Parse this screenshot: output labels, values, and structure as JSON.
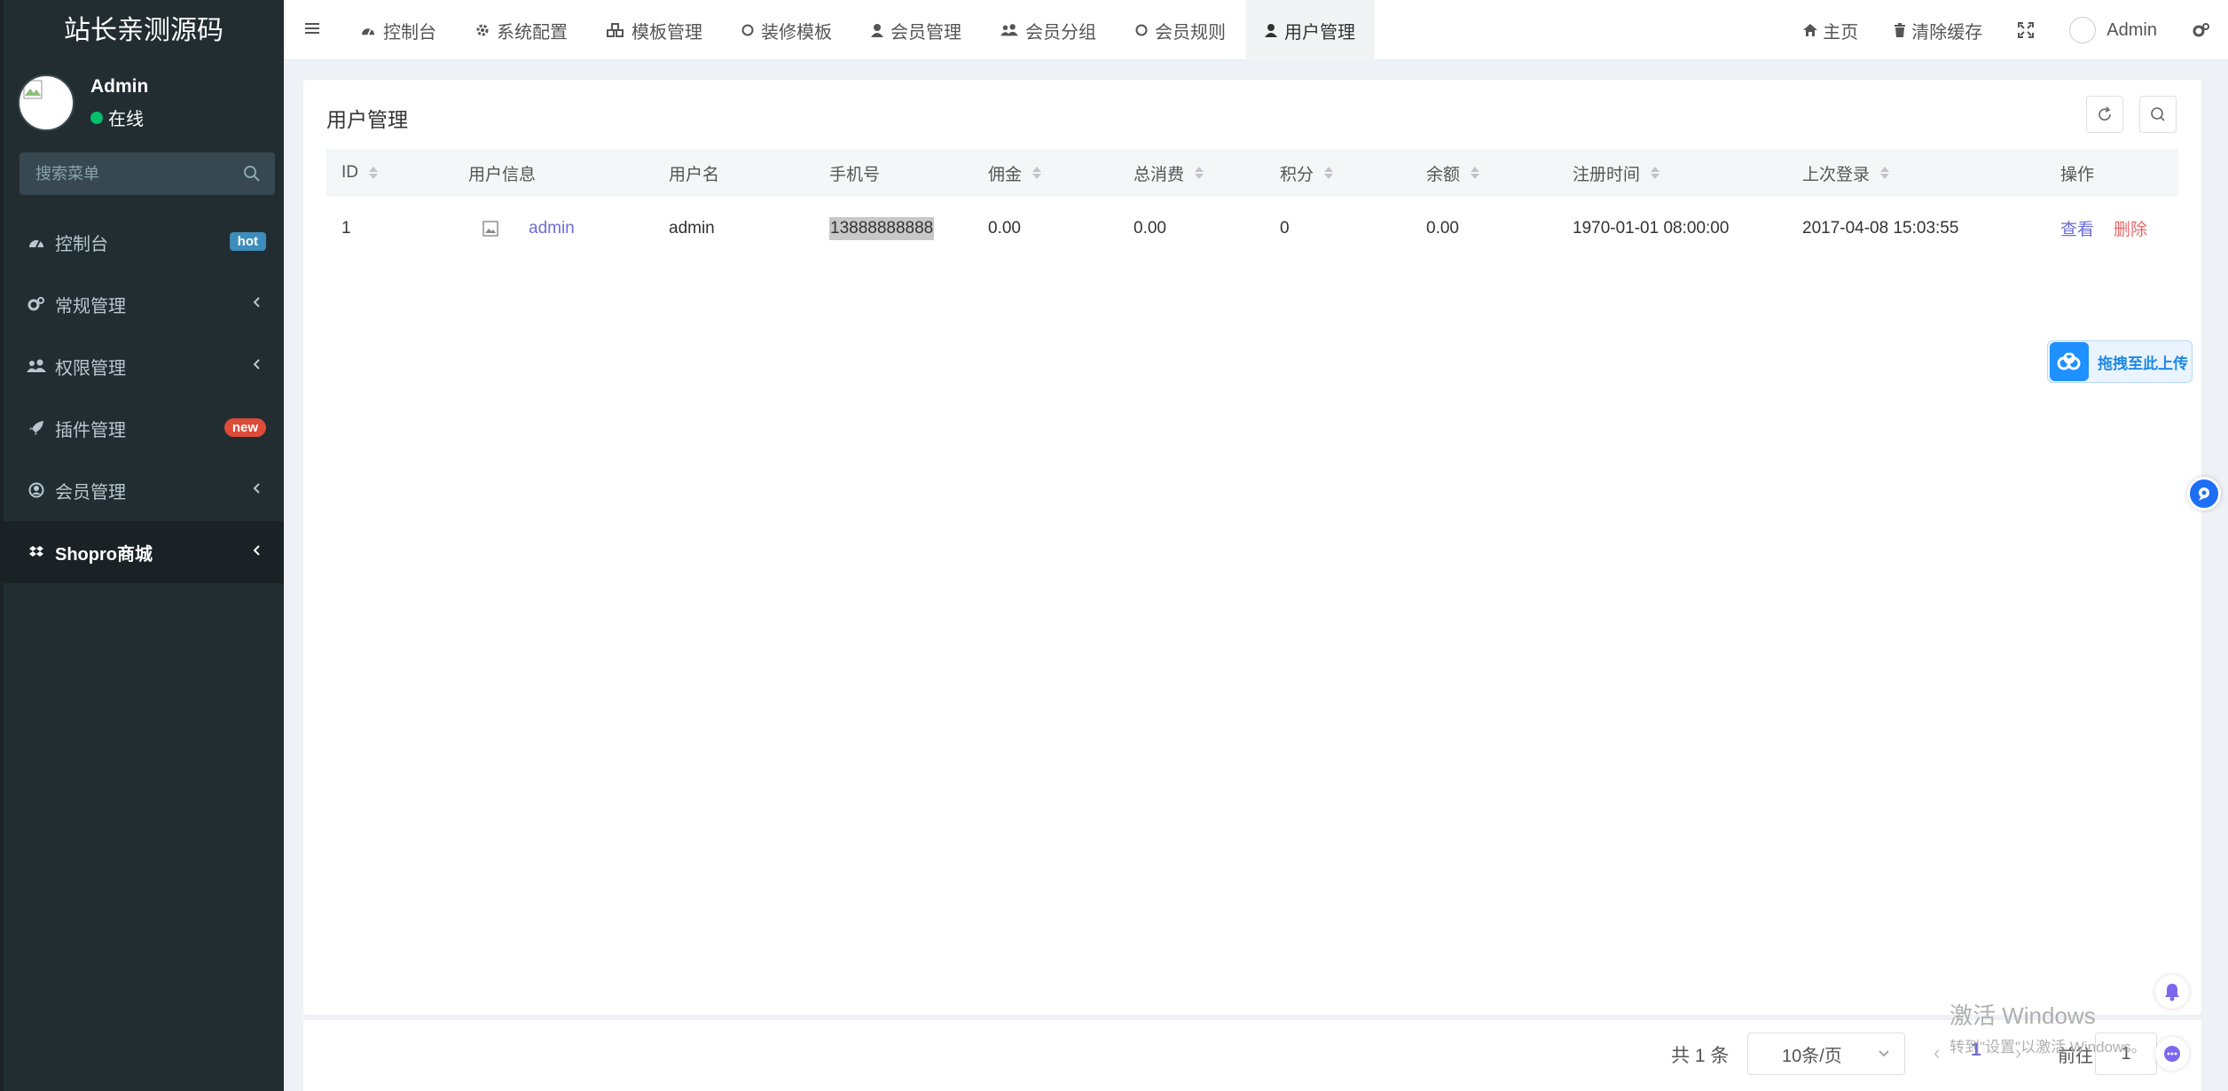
{
  "sidebar": {
    "logo": "站长亲测源码",
    "user": {
      "name": "Admin",
      "status": "在线"
    },
    "search_placeholder": "搜索菜单",
    "items": [
      {
        "label": "控制台",
        "badge": "hot",
        "icon": "dashboard-icon"
      },
      {
        "label": "常规管理",
        "icon": "cogs-icon"
      },
      {
        "label": "权限管理",
        "icon": "users-icon"
      },
      {
        "label": "插件管理",
        "badge": "new",
        "icon": "rocket-icon"
      },
      {
        "label": "会员管理",
        "icon": "user-circle-icon"
      },
      {
        "label": "Shopro商城",
        "icon": "dropbox-icon"
      }
    ]
  },
  "navbar": {
    "tabs": [
      {
        "label": "控制台",
        "icon": "dashboard-icon"
      },
      {
        "label": "系统配置",
        "icon": "gear-icon"
      },
      {
        "label": "模板管理",
        "icon": "cubes-icon"
      },
      {
        "label": "装修模板",
        "icon": "circle-icon"
      },
      {
        "label": "会员管理",
        "icon": "user-icon"
      },
      {
        "label": "会员分组",
        "icon": "users-icon"
      },
      {
        "label": "会员规则",
        "icon": "circle-icon"
      },
      {
        "label": "用户管理",
        "icon": "user-icon"
      }
    ],
    "active_tab": "用户管理",
    "right": {
      "home": "主页",
      "clear_cache": "清除缓存",
      "user": "Admin"
    }
  },
  "panel": {
    "title": "用户管理",
    "columns": [
      "ID",
      "用户信息",
      "用户名",
      "手机号",
      "佣金",
      "总消费",
      "积分",
      "余额",
      "注册时间",
      "上次登录",
      "操作"
    ],
    "rows": [
      {
        "id": "1",
        "nickname": "admin",
        "username": "admin",
        "mobile": "13888888888",
        "commission": "0.00",
        "total_consume": "0.00",
        "score": "0",
        "money": "0.00",
        "register_time": "1970-01-01 08:00:00",
        "last_login": "2017-04-08 15:03:55",
        "action_view": "查看",
        "action_delete": "删除"
      }
    ]
  },
  "pagination": {
    "total": "共 1 条",
    "page_size": "10条/页",
    "current_page": "1",
    "goto_label": "前往",
    "goto_value": "1"
  },
  "floating": {
    "upload": "拖拽至此上传"
  },
  "watermark": {
    "line1": "激活 Windows",
    "line2": "转到\"设置\"以激活 Windows。"
  },
  "colors": {
    "sidebar_bg": "#222d32",
    "accent_link": "#6d6dd6",
    "danger": "#e86a6a",
    "online": "#00c06b",
    "badge_hot": "#3c8dbc",
    "badge_new": "#dd4b39"
  }
}
